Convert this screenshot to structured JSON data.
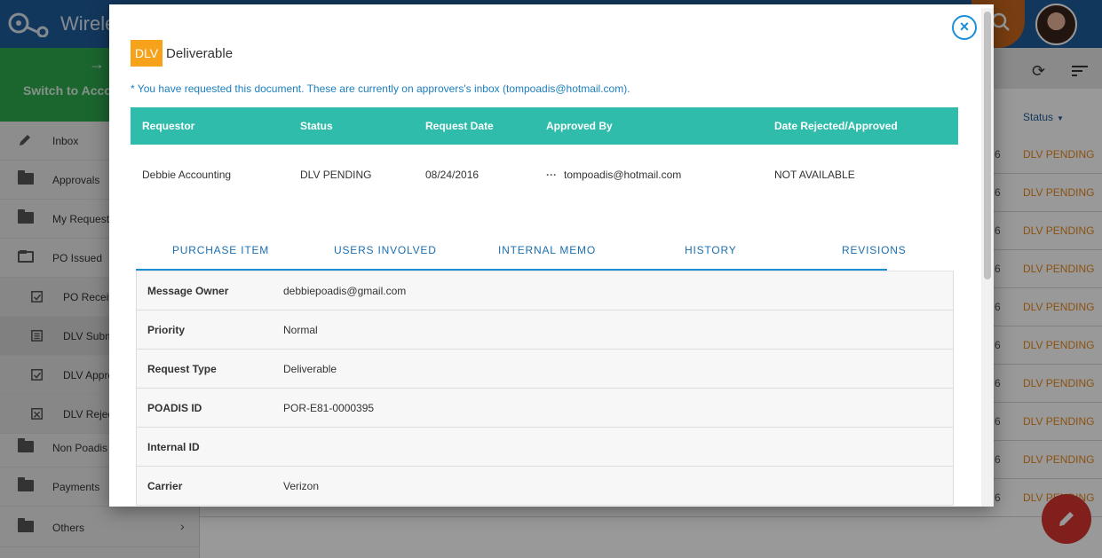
{
  "app": {
    "title": "Wirele"
  },
  "sidebar": {
    "switch_label": "Switch to Acco",
    "switch_arrow": "→",
    "items": [
      {
        "label": "Inbox",
        "icon": "pencil-icon"
      },
      {
        "label": "Approvals",
        "icon": "folder-icon"
      },
      {
        "label": "My Requests",
        "icon": "folder-icon"
      },
      {
        "label": "PO Issued",
        "icon": "folder-open-icon"
      },
      {
        "label": "PO Receiv",
        "icon": "checkbox-doc-icon"
      },
      {
        "label": "DLV Subm",
        "icon": "list-doc-icon"
      },
      {
        "label": "DLV Appro",
        "icon": "checkbox-doc-icon"
      },
      {
        "label": "DLV Rejec",
        "icon": "x-doc-icon"
      },
      {
        "label": "Non Poadis",
        "icon": "folder-icon"
      },
      {
        "label": "Payments",
        "icon": "folder-icon"
      },
      {
        "label": "Others",
        "icon": "folder-icon",
        "chevron": "›"
      }
    ]
  },
  "main": {
    "status_header": "Status",
    "caret": "▼",
    "row_num": "6",
    "row_status": "DLV PENDING",
    "refresh_glyph": "⟳"
  },
  "modal": {
    "close_glyph": "×",
    "badge": "DLV",
    "type_label": "Deliverable",
    "notice": "* You have requested this document. These are currently on approvers's inbox (tompoadis@hotmail.com).",
    "request_table": {
      "headers": [
        "Requestor",
        "Status",
        "Request Date",
        "Approved By",
        "Date Rejected/Approved"
      ],
      "row": {
        "requestor": "Debbie Accounting",
        "status": "DLV PENDING",
        "request_date": "08/24/2016",
        "approved_by_dots": "···",
        "approved_by": "tompoadis@hotmail.com",
        "date_rejected_approved": "NOT AVAILABLE"
      }
    },
    "tabs": [
      "PURCHASE ITEM",
      "USERS INVOLVED",
      "INTERNAL MEMO",
      "HISTORY",
      "REVISIONS"
    ],
    "details": [
      {
        "key": "Message Owner",
        "value": "debbiepoadis@gmail.com"
      },
      {
        "key": "Priority",
        "value": "Normal"
      },
      {
        "key": "Request Type",
        "value": "Deliverable"
      },
      {
        "key": "POADIS ID",
        "value": "POR-E81-0000395"
      },
      {
        "key": "Internal ID",
        "value": ""
      },
      {
        "key": "Carrier",
        "value": "Verizon"
      }
    ]
  },
  "colors": {
    "header_bg": "#1f5c99",
    "switch_bg": "#2ea84f",
    "table_head": "#2fbcab",
    "accent_blue": "#1b8fd6",
    "badge_orange": "#f7a21b",
    "pending_orange": "#e8891f",
    "fab_red": "#d6342e"
  }
}
